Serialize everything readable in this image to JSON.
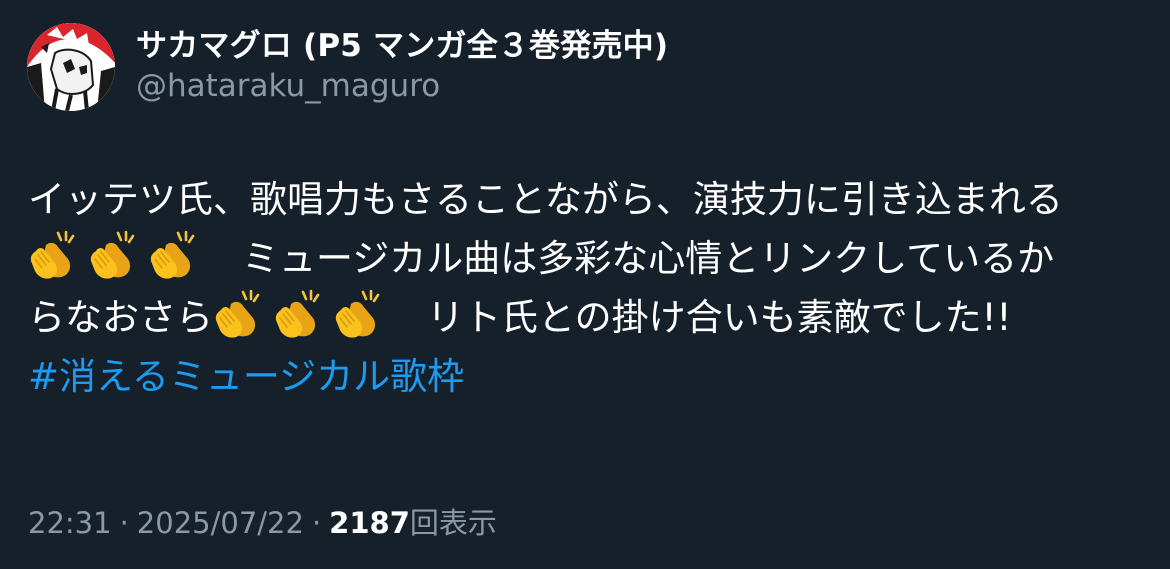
{
  "author": {
    "display_name": "サカマグロ (P5 マンガ全３巻発売中)",
    "handle": "@hataraku_maguro",
    "avatar_icon": "avatar-illustration-icon"
  },
  "tweet": {
    "line1": "イッテツ氏、歌唱力もさることながら、演技力に引き込まれる",
    "line2_text": "ミュージカル曲は多彩な心情とリンクしているか",
    "line3_start": "らなおさら",
    "line3_end": "リト氏との掛け合いも素敵でした!!",
    "hashtag": "#消えるミュージカル歌枠",
    "emoji_icon": "clapping-hands-icon"
  },
  "meta": {
    "time": "22:31",
    "separator": "·",
    "date": "2025/07/22",
    "views_count": "2187",
    "views_label": "回表示"
  },
  "colors": {
    "background": "#15202b",
    "text": "#ffffff",
    "secondary": "#8b98a5",
    "link": "#1d9bf0"
  }
}
